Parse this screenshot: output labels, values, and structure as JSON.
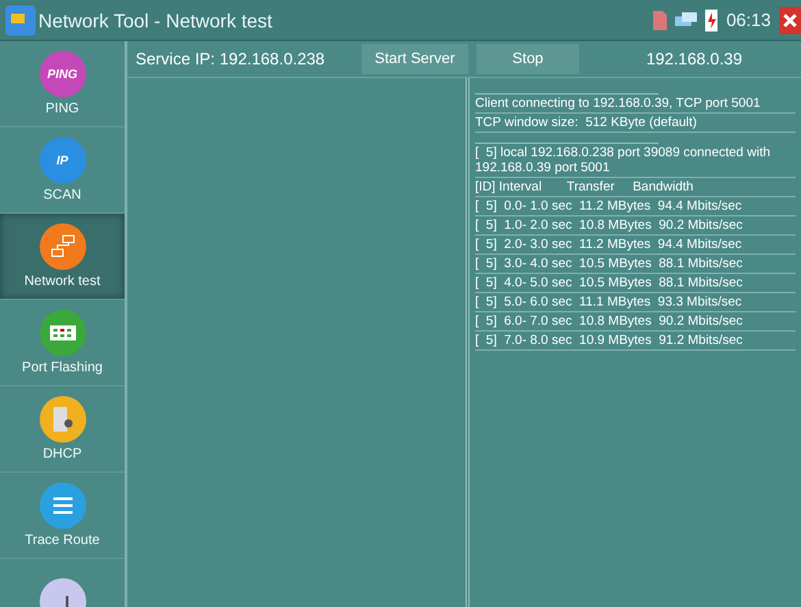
{
  "window": {
    "title": "Network Tool - Network test",
    "time": "06:13"
  },
  "sidebar": {
    "items": [
      {
        "label": "PING",
        "icon_text": "PING",
        "selected": false
      },
      {
        "label": "SCAN",
        "icon_text": "IP",
        "selected": false
      },
      {
        "label": "Network test",
        "selected": true
      },
      {
        "label": "Port Flashing",
        "selected": false
      },
      {
        "label": "DHCP",
        "selected": false
      },
      {
        "label": "Trace Route",
        "selected": false
      },
      {
        "selected": false
      }
    ]
  },
  "toolbar": {
    "service_ip": "Service IP: 192.168.0.238",
    "buttons": [
      "Start Server",
      "Stop"
    ],
    "client_ip": "192.168.0.39"
  },
  "log": [
    {
      "kind": "rule"
    },
    {
      "kind": "text",
      "text": "Client connecting to 192.168.0.39, TCP port 5001"
    },
    {
      "kind": "text",
      "text": "TCP window size:  512 KByte (default)"
    },
    {
      "kind": "rule"
    },
    {
      "kind": "text",
      "text": "[  5] local 192.168.0.238 port 39089 connected with 192.168.0.39 port 5001"
    },
    {
      "kind": "text",
      "text": "[ID] Interval       Transfer     Bandwidth"
    },
    {
      "kind": "text",
      "text": "[  5]  0.0- 1.0 sec  11.2 MBytes  94.4 Mbits/sec"
    },
    {
      "kind": "text",
      "text": "[  5]  1.0- 2.0 sec  10.8 MBytes  90.2 Mbits/sec"
    },
    {
      "kind": "text",
      "text": "[  5]  2.0- 3.0 sec  11.2 MBytes  94.4 Mbits/sec"
    },
    {
      "kind": "text",
      "text": "[  5]  3.0- 4.0 sec  10.5 MBytes  88.1 Mbits/sec"
    },
    {
      "kind": "text",
      "text": "[  5]  4.0- 5.0 sec  10.5 MBytes  88.1 Mbits/sec"
    },
    {
      "kind": "text",
      "text": "[  5]  5.0- 6.0 sec  11.1 MBytes  93.3 Mbits/sec"
    },
    {
      "kind": "text",
      "text": "[  5]  6.0- 7.0 sec  10.8 MBytes  90.2 Mbits/sec"
    },
    {
      "kind": "text",
      "text": "[  5]  7.0- 8.0 sec  10.9 MBytes  91.2 Mbits/sec"
    }
  ]
}
